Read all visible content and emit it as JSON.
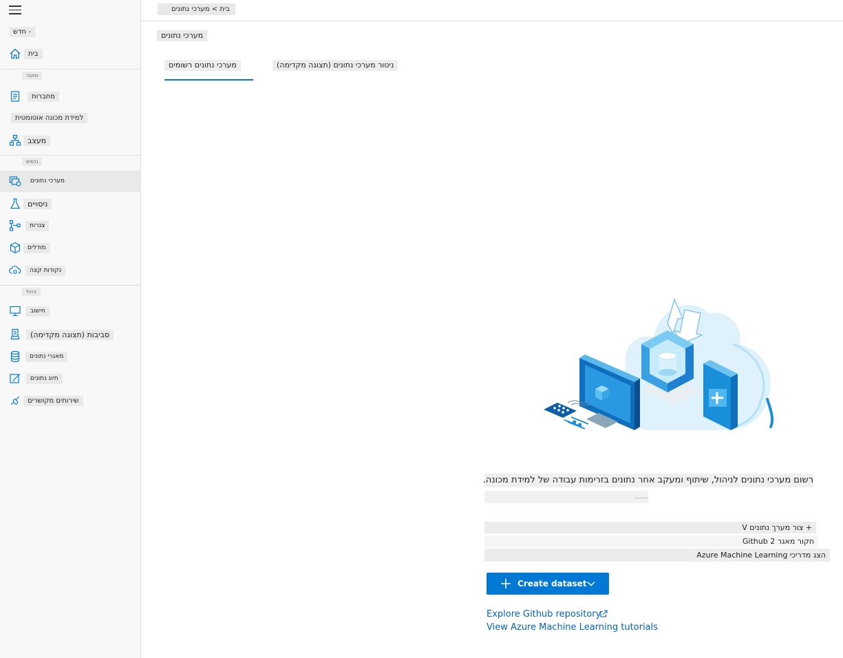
{
  "sidebar": {
    "new_label": "- חדש",
    "home_label": "בית",
    "section_author": "מחבר",
    "section_assets": "נכסים",
    "section_manage": "ניהול",
    "items": {
      "notebooks": "מחברות",
      "automl": "למידת מכונה אוטומטית",
      "designer": "מעצב",
      "datasets": "מערכי נתונים",
      "experiments": "ניסויים",
      "pipelines": "צנרות",
      "models": "מודלים",
      "endpoints": "נקודות קצה",
      "compute": "חישוב",
      "environments": "סביבות (תצוגה מקדימה)",
      "datastores": "מאגרי נתונים",
      "labeling": "תיוג נתונים",
      "linked_services": "שירותים מקושרים"
    }
  },
  "header": {
    "breadcrumb": "בית > מערכי נתונים",
    "page_title": "מערכי נתונים"
  },
  "tabs": [
    {
      "label": "מערכי נתונים רשומים",
      "selected": true
    },
    {
      "label": "ניטור מערכי נתונים (תצוגה מקדימה)",
      "selected": false
    }
  ],
  "empty_state": {
    "description": "רשום מערכי נתונים לניהול, שיתוף ומעקב אחר נתונים בזרימות עבודה של למידת מכונה.",
    "sub_description": ".........",
    "hints": [
      "+ צור מערך נתונים V",
      "חקור מאגר 2 Github",
      "הצג מדריכי Azure Machine Learning"
    ],
    "create_button_label": "Create dataset",
    "link_github": "Explore Github repository",
    "link_tutorials": "View Azure Machine Learning tutorials"
  },
  "colors": {
    "accent": "#0078d4",
    "link": "#0064bf",
    "sidebar_bg": "#f8f8f8",
    "chip_bg": "#e9e9e9"
  },
  "icons": {
    "menu": "hamburger-icon",
    "home": "home-icon",
    "notebooks": "notebook-icon",
    "designer": "hierarchy-icon",
    "datasets": "dataset-icon",
    "experiments": "flask-icon",
    "pipelines": "pipeline-icon",
    "models": "cube-icon",
    "endpoints": "cloud-endpoint-icon",
    "compute": "monitor-icon",
    "environments": "environment-icon",
    "datastores": "database-icon",
    "labeling": "edit-icon",
    "linked_services": "link-icon",
    "create": "plus-icon",
    "dropdown": "chevron-down-icon",
    "external": "external-link-icon"
  }
}
